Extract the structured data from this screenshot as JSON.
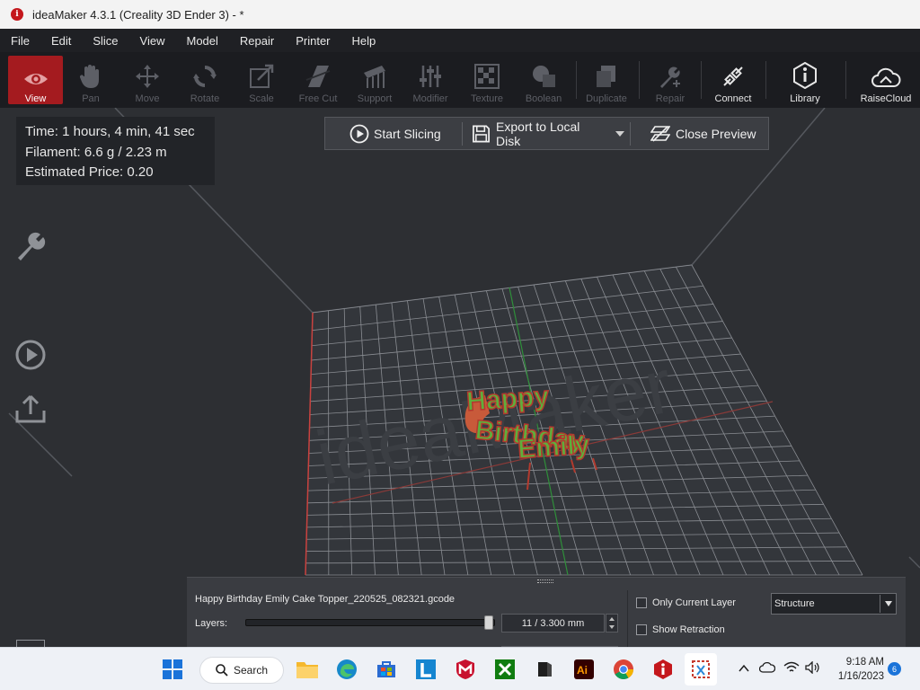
{
  "window": {
    "title": "ideaMaker 4.3.1 (Creality 3D Ender 3) - *",
    "app_icon": "ideamaker-icon"
  },
  "menu": [
    "File",
    "Edit",
    "Slice",
    "View",
    "Model",
    "Repair",
    "Printer",
    "Help"
  ],
  "toolbar": {
    "view": "View",
    "pan": "Pan",
    "move": "Move",
    "rotate": "Rotate",
    "scale": "Scale",
    "free_cut": "Free Cut",
    "support": "Support",
    "modifier": "Modifier",
    "texture": "Texture",
    "boolean": "Boolean",
    "duplicate": "Duplicate",
    "repair": "Repair",
    "connect": "Connect",
    "library": "Library",
    "raisecloud": "RaiseCloud",
    "active_color": "#a41b1f"
  },
  "info": {
    "time": "Time: 1 hours, 4 min, 41 sec",
    "filament": "Filament: 6.6 g / 2.23 m",
    "price": "Estimated Price: 0.20"
  },
  "actions": {
    "start_slicing": "Start Slicing",
    "export": "Export to Local Disk",
    "close_preview": "Close Preview"
  },
  "scene": {
    "watermark": "ideaMaker",
    "model_text": [
      "Happy",
      "Birthday",
      "Emily"
    ]
  },
  "preview_panel": {
    "filename": "Happy Birthday Emily Cake Topper_220525_082321.gcode",
    "layers_label": "Layers:",
    "layer_value": "11 / 3.300 mm",
    "layer_progress": 0.99,
    "only_current_layer": "Only Current Layer",
    "show_retraction": "Show Retraction",
    "view_mode": "Structure"
  },
  "taskbar": {
    "search": "Search",
    "time": "9:18 AM",
    "date": "1/16/2023",
    "notifications": "6"
  }
}
